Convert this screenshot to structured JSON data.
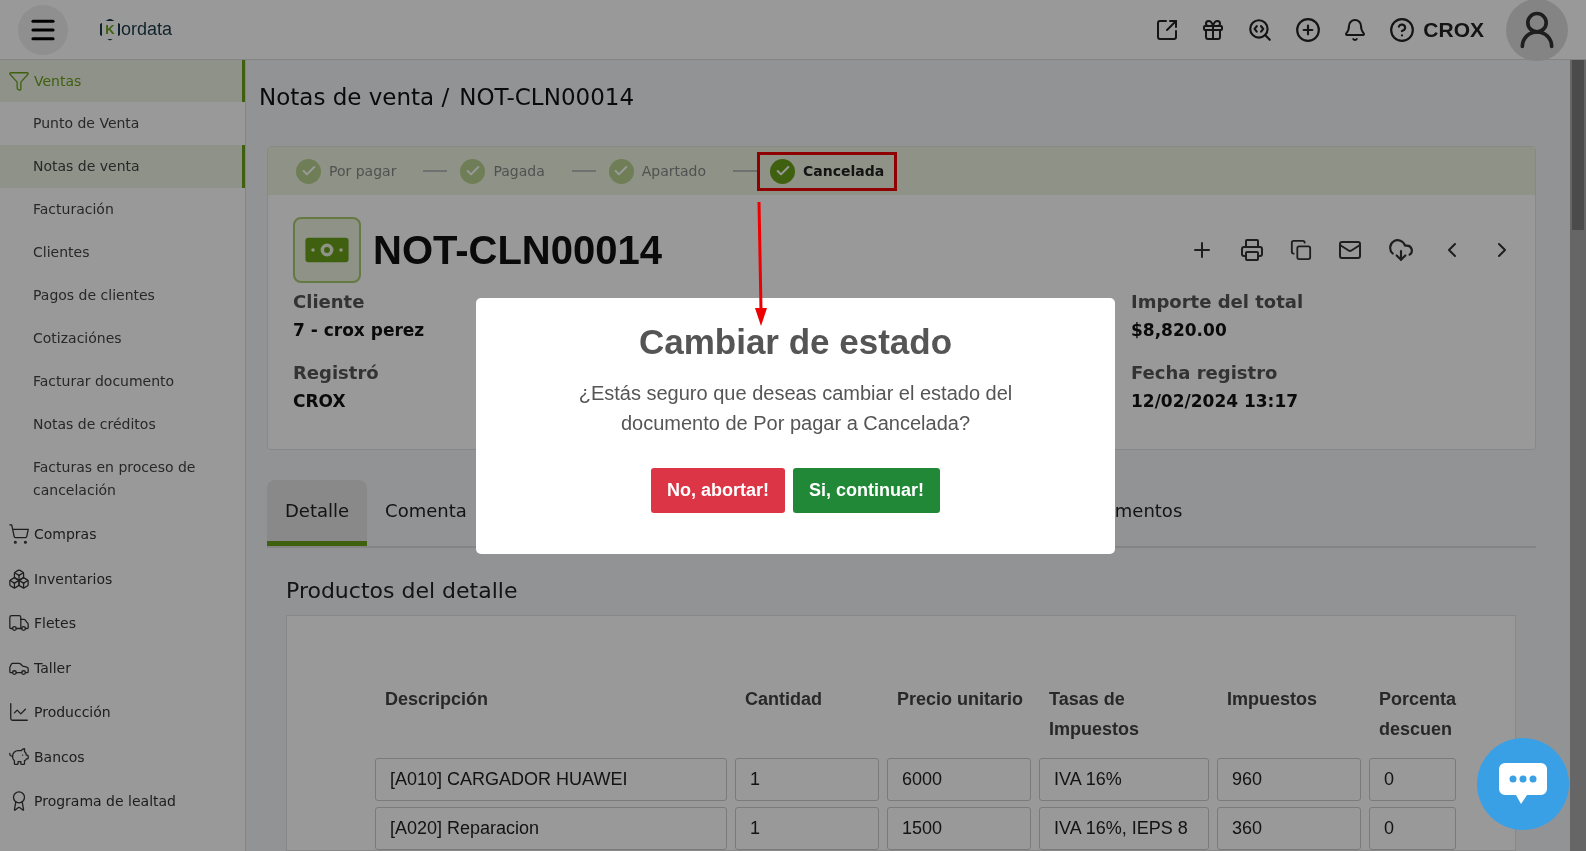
{
  "topbar": {
    "logo": {
      "mark": "K",
      "text": "ordata"
    },
    "user": "CROX"
  },
  "sidebar": {
    "sections": [
      {
        "label": "Ventas",
        "selected": true,
        "children": [
          {
            "label": "Punto de Venta",
            "selected": false
          },
          {
            "label": "Notas de venta",
            "selected": true
          },
          {
            "label": "Facturación",
            "selected": false
          },
          {
            "label": "Clientes",
            "selected": false
          },
          {
            "label": "Pagos de clientes",
            "selected": false
          },
          {
            "label": "Cotizaciónes",
            "selected": false
          },
          {
            "label": "Facturar documento",
            "selected": false
          },
          {
            "label": "Notas de créditos",
            "selected": false
          },
          {
            "label": "Facturas en proceso de cancelación",
            "selected": false
          }
        ]
      },
      {
        "label": "Compras",
        "selected": false
      },
      {
        "label": "Inventarios",
        "selected": false
      },
      {
        "label": "Fletes",
        "selected": false
      },
      {
        "label": "Taller",
        "selected": false
      },
      {
        "label": "Producción",
        "selected": false
      },
      {
        "label": "Bancos",
        "selected": false
      },
      {
        "label": "Programa de lealtad",
        "selected": false
      }
    ]
  },
  "breadcrumb": [
    "Notas de venta /",
    "NOT-CLN00014"
  ],
  "steps": [
    {
      "label": "Por pagar",
      "selected": false
    },
    {
      "label": "Pagada",
      "selected": false
    },
    {
      "label": "Apartado",
      "selected": false
    },
    {
      "label": "Cancelada",
      "selected": true
    }
  ],
  "document": {
    "title": "NOT-CLN00014",
    "fields_left": [
      {
        "label": "Cliente",
        "value": "7 - crox perez"
      },
      {
        "label": "Registró",
        "value": "CROX"
      }
    ],
    "fields_right": [
      {
        "label": "Importe del total",
        "value": "$8,820.00"
      },
      {
        "label": "Fecha registro",
        "value": "12/02/2024 13:17"
      }
    ]
  },
  "tabs": [
    {
      "label": "Detalle",
      "selected": true
    },
    {
      "label": "Comenta",
      "selected": false
    },
    {
      "label": "mentos",
      "selected": false
    }
  ],
  "products": {
    "title": "Productos del detalle",
    "columns": [
      "Descripción",
      "Cantidad",
      "Precio unitario",
      "Tasas de Impuestos",
      "Impuestos",
      "Porcenta descuen"
    ],
    "rows": [
      [
        "[A010] CARGADOR HUAWEI",
        "1",
        "6000",
        "IVA 16%",
        "960",
        "0"
      ],
      [
        "[A020] Reparacion",
        "1",
        "1500",
        "IVA 16%, IEPS 8",
        "360",
        "0"
      ]
    ]
  },
  "dialog": {
    "title": "Cambiar de estado",
    "message": "¿Estás seguro que deseas cambiar el estado del documento de Por pagar a Cancelada?",
    "cancel": "No, abortar!",
    "confirm": "Si, continuar!"
  }
}
